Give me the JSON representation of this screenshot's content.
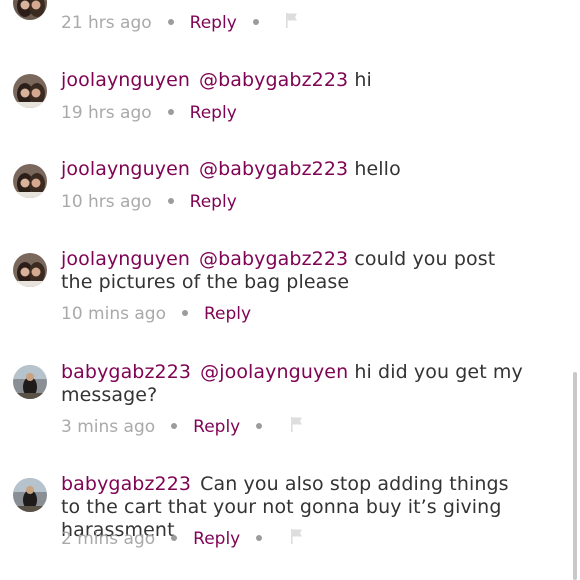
{
  "top_partial": {
    "timestamp": "21 hrs ago",
    "reply_label": "Reply",
    "flag_icon": "flag-icon"
  },
  "comments": [
    {
      "username": "joolaynguyen",
      "mention": "@babygabz223",
      "text": "hi",
      "timestamp": "19 hrs ago",
      "reply_label": "Reply",
      "show_flag": false,
      "avatar": "user-avatar-joolaynguyen"
    },
    {
      "username": "joolaynguyen",
      "mention": "@babygabz223",
      "text": "hello",
      "timestamp": "10 hrs ago",
      "reply_label": "Reply",
      "show_flag": false,
      "avatar": "user-avatar-joolaynguyen"
    },
    {
      "username": "joolaynguyen",
      "mention": "@babygabz223",
      "text": "could you post the pictures of the bag please",
      "timestamp": "10 mins ago",
      "reply_label": "Reply",
      "show_flag": false,
      "avatar": "user-avatar-joolaynguyen"
    },
    {
      "username": "babygabz223",
      "mention": "@joolaynguyen",
      "text": "hi did you get my message?",
      "timestamp": "3 mins ago",
      "reply_label": "Reply",
      "show_flag": true,
      "avatar": "user-avatar-babygabz223"
    },
    {
      "username": "babygabz223",
      "mention": "",
      "text": "Can you also stop adding things to the cart that your not gonna buy it’s giving harassment",
      "timestamp": "2 mins ago",
      "reply_label": "Reply",
      "show_flag": true,
      "avatar": "user-avatar-babygabz223"
    }
  ],
  "colors": {
    "brand": "#7f0353",
    "text": "#333333",
    "muted": "#a9a9a9",
    "flag": "#dddddd"
  }
}
